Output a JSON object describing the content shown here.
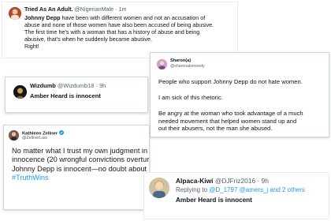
{
  "tweet1": {
    "name": "Tried As An Adult.",
    "handle": "@NigerianMale",
    "time": "· 1m",
    "lines": [
      [
        "Johnny Depp",
        " have been with different women and not an accusation of"
      ],
      [
        "abuse and none of those women have also been accused of being abusive.",
        ""
      ],
      [
        "The first time he's with a woman that has a history of abuse and being",
        ""
      ],
      [
        "abusive, that's when he suddenly became abusive.",
        ""
      ],
      [
        "Right!",
        ""
      ]
    ]
  },
  "tweet2": {
    "name": "Wizdumb",
    "handle": "@Wizdumb18",
    "time": "· 9h",
    "text": "Amber Heard is innocent"
  },
  "tweet3": {
    "name": "Sharon(a)",
    "handle": "@sharonakennedy",
    "p1": "People who support Johnny Depp do not hate women.",
    "p2": "I am sick of this rhetoric.",
    "p3": [
      "Be angry at the woman who took advantage of a much",
      "needed movement that helped women stand up and",
      "out their abusers, not the man she abused."
    ]
  },
  "tweet4": {
    "name": "Kathleen Zellner",
    "handle": "@ZellnerLaw",
    "lines": [
      "No matter what I trust my own judgment in detecting",
      "innocence (20 wrongful convictions overturned).",
      "Johnny Depp is innocent—no doubt about it."
    ],
    "hashtag": "#TruthWins"
  },
  "tweet5": {
    "name": "Alpaca-Kiwi",
    "handle": "@DJFriz2016",
    "time": "· 9h",
    "reply_prefix": "Replying to ",
    "reply_users": "@D_1797 @amers_j",
    "reply_suffix": " and 2 others",
    "text": "Amber Heard is innocent"
  },
  "colors": {
    "link": "#1d9bf0",
    "muted": "#536471",
    "border": "#cfd9de",
    "verified": "#1d9bf0"
  }
}
